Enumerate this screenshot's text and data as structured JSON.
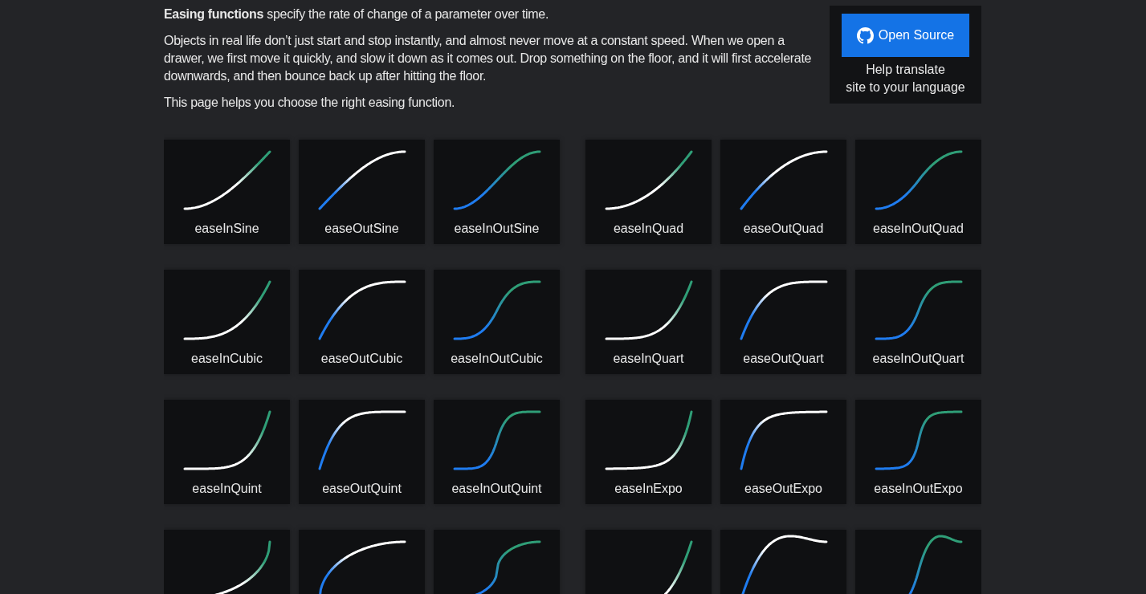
{
  "intro": {
    "paragraphs": [
      "**Easing functions** specify the rate of change of a parameter over time.",
      "Objects in real life don’t just start and stop instantly, and almost never move at a constant speed. When we open a drawer, we first move it quickly, and slow it down as it comes out. Drop something on the floor, and it will first accelerate downwards, and then bounce back up after hitting the floor.",
      "This page helps you choose the right easing function."
    ]
  },
  "sidebar": {
    "button": "Open Source",
    "help_text": "Help translate\nsite to your language"
  },
  "easings": [
    {
      "name": "easeInSine",
      "kind": "sinein"
    },
    {
      "name": "easeOutSine",
      "kind": "sineout"
    },
    {
      "name": "easeInOutSine",
      "kind": "sineinout"
    },
    {
      "name": "easeInQuad",
      "kind": "quadin"
    },
    {
      "name": "easeOutQuad",
      "kind": "quadout"
    },
    {
      "name": "easeInOutQuad",
      "kind": "quadinout"
    },
    {
      "name": "easeInCubic",
      "kind": "cubicin"
    },
    {
      "name": "easeOutCubic",
      "kind": "cubicout"
    },
    {
      "name": "easeInOutCubic",
      "kind": "cubicinout"
    },
    {
      "name": "easeInQuart",
      "kind": "quartin"
    },
    {
      "name": "easeOutQuart",
      "kind": "quartout"
    },
    {
      "name": "easeInOutQuart",
      "kind": "quartinout"
    },
    {
      "name": "easeInQuint",
      "kind": "quintin"
    },
    {
      "name": "easeOutQuint",
      "kind": "quintout"
    },
    {
      "name": "easeInOutQuint",
      "kind": "quintinout"
    },
    {
      "name": "easeInExpo",
      "kind": "expoin"
    },
    {
      "name": "easeOutExpo",
      "kind": "expoout"
    },
    {
      "name": "easeInOutExpo",
      "kind": "expoinout"
    },
    {
      "kind": "circin"
    },
    {
      "kind": "circout"
    },
    {
      "kind": "circinout"
    },
    {
      "kind": "backin"
    },
    {
      "kind": "backout"
    },
    {
      "kind": "backinout"
    }
  ]
}
